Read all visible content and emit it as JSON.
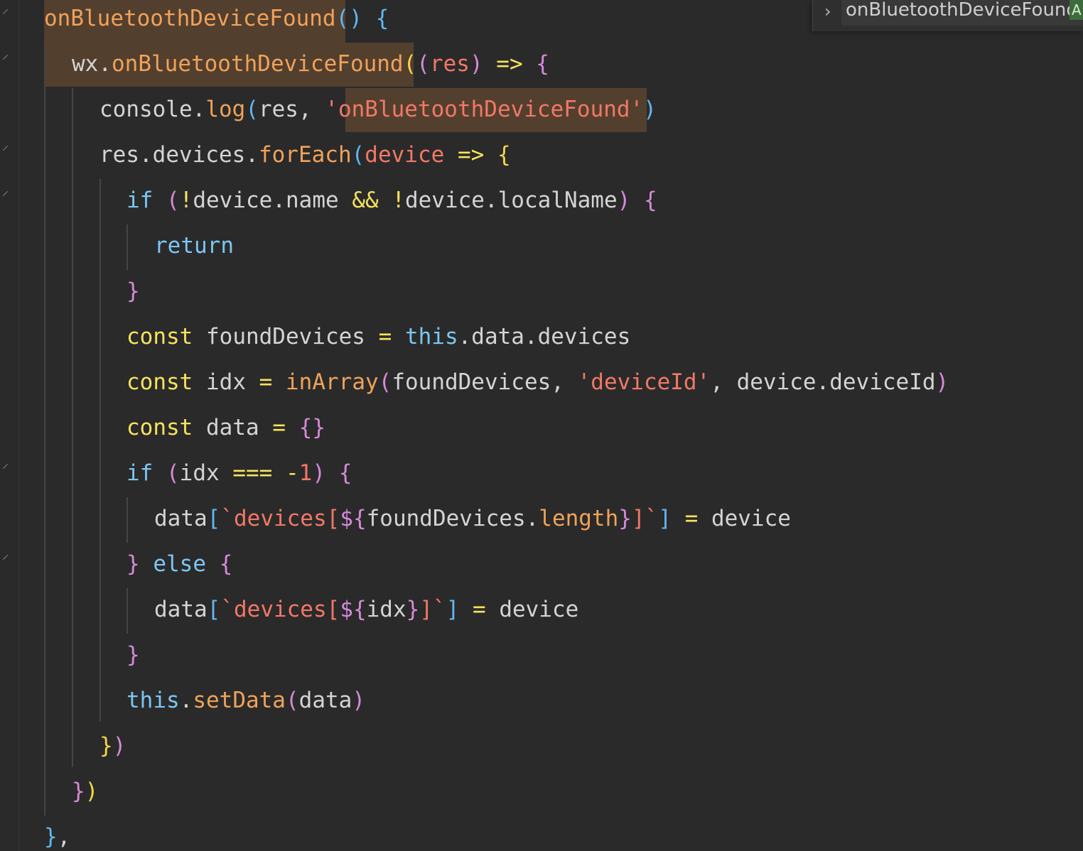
{
  "breadcrumb": {
    "chevron_icon": "chevron-right-icon",
    "symbol": "onBluetoothDeviceFound",
    "badge": "A"
  },
  "colors": {
    "background": "#2a2a2a",
    "function": "#f0a25a",
    "keyword": "#7cc6f2",
    "declaration": "#f7e25f",
    "string": "#f27866",
    "plain": "#d4d4d4",
    "selection_highlight": "#533f2e"
  },
  "lines": [
    [
      [
        "fn",
        "onBluetoothDeviceFound"
      ],
      [
        "pB",
        "()"
      ],
      [
        "plain",
        " "
      ],
      [
        "pB",
        "{"
      ]
    ],
    [
      [
        "plain",
        "wx."
      ],
      [
        "fn",
        "onBluetoothDeviceFound"
      ],
      [
        "pY",
        "("
      ],
      [
        "pM",
        "("
      ],
      [
        "str",
        "res"
      ],
      [
        "pM",
        ")"
      ],
      [
        "plain",
        " "
      ],
      [
        "op",
        "=>"
      ],
      [
        "plain",
        " "
      ],
      [
        "pM",
        "{"
      ]
    ],
    [
      [
        "plain",
        "console."
      ],
      [
        "fn",
        "log"
      ],
      [
        "pB",
        "("
      ],
      [
        "plain",
        "res, "
      ],
      [
        "str",
        "'onBluetoothDeviceFound'"
      ],
      [
        "pB",
        ")"
      ]
    ],
    [
      [
        "plain",
        "res.devices."
      ],
      [
        "fn",
        "forEach"
      ],
      [
        "pB",
        "("
      ],
      [
        "str",
        "device"
      ],
      [
        "plain",
        " "
      ],
      [
        "op",
        "=>"
      ],
      [
        "plain",
        " "
      ],
      [
        "pY",
        "{"
      ]
    ],
    [
      [
        "kw",
        "if"
      ],
      [
        "plain",
        " "
      ],
      [
        "pM",
        "("
      ],
      [
        "op",
        "!"
      ],
      [
        "plain",
        "device.name "
      ],
      [
        "op",
        "&&"
      ],
      [
        "plain",
        " "
      ],
      [
        "op",
        "!"
      ],
      [
        "plain",
        "device.localName"
      ],
      [
        "pM",
        ")"
      ],
      [
        "plain",
        " "
      ],
      [
        "pM",
        "{"
      ]
    ],
    [
      [
        "kw",
        "return"
      ]
    ],
    [
      [
        "pM",
        "}"
      ]
    ],
    [
      [
        "decl",
        "const"
      ],
      [
        "plain",
        " foundDevices "
      ],
      [
        "op",
        "="
      ],
      [
        "plain",
        " "
      ],
      [
        "kw",
        "this"
      ],
      [
        "plain",
        ".data.devices"
      ]
    ],
    [
      [
        "decl",
        "const"
      ],
      [
        "plain",
        " idx "
      ],
      [
        "op",
        "="
      ],
      [
        "plain",
        " "
      ],
      [
        "fn",
        "inArray"
      ],
      [
        "pM",
        "("
      ],
      [
        "plain",
        "foundDevices, "
      ],
      [
        "str",
        "'deviceId'"
      ],
      [
        "plain",
        ", device.deviceId"
      ],
      [
        "pM",
        ")"
      ]
    ],
    [
      [
        "decl",
        "const"
      ],
      [
        "plain",
        " data "
      ],
      [
        "op",
        "="
      ],
      [
        "plain",
        " "
      ],
      [
        "pM",
        "{}"
      ]
    ],
    [
      [
        "kw",
        "if"
      ],
      [
        "plain",
        " "
      ],
      [
        "pM",
        "("
      ],
      [
        "plain",
        "idx "
      ],
      [
        "op",
        "==="
      ],
      [
        "plain",
        " "
      ],
      [
        "op",
        "-"
      ],
      [
        "num",
        "1"
      ],
      [
        "pM",
        ")"
      ],
      [
        "plain",
        " "
      ],
      [
        "pM",
        "{"
      ]
    ],
    [
      [
        "plain",
        "data"
      ],
      [
        "pB",
        "["
      ],
      [
        "str",
        "`devices["
      ],
      [
        "pM",
        "${"
      ],
      [
        "plain",
        "foundDevices."
      ],
      [
        "fn",
        "length"
      ],
      [
        "pM",
        "}"
      ],
      [
        "str",
        "]`"
      ],
      [
        "pB",
        "]"
      ],
      [
        "plain",
        " "
      ],
      [
        "op",
        "="
      ],
      [
        "plain",
        " device"
      ]
    ],
    [
      [
        "pM",
        "}"
      ],
      [
        "plain",
        " "
      ],
      [
        "kw",
        "else"
      ],
      [
        "plain",
        " "
      ],
      [
        "pM",
        "{"
      ]
    ],
    [
      [
        "plain",
        "data"
      ],
      [
        "pB",
        "["
      ],
      [
        "str",
        "`devices["
      ],
      [
        "pM",
        "${"
      ],
      [
        "plain",
        "idx"
      ],
      [
        "pM",
        "}"
      ],
      [
        "str",
        "]`"
      ],
      [
        "pB",
        "]"
      ],
      [
        "plain",
        " "
      ],
      [
        "op",
        "="
      ],
      [
        "plain",
        " device"
      ]
    ],
    [
      [
        "pM",
        "}"
      ]
    ],
    [
      [
        "kw",
        "this"
      ],
      [
        "plain",
        "."
      ],
      [
        "fn",
        "setData"
      ],
      [
        "pM",
        "("
      ],
      [
        "plain",
        "data"
      ],
      [
        "pM",
        ")"
      ]
    ],
    [
      [
        "pY",
        "}"
      ],
      [
        "pM",
        ")"
      ]
    ],
    [
      [
        "pM",
        "}"
      ],
      [
        "pY",
        ")"
      ]
    ],
    [
      [
        "pB",
        "}"
      ],
      [
        "plain",
        ","
      ]
    ]
  ]
}
